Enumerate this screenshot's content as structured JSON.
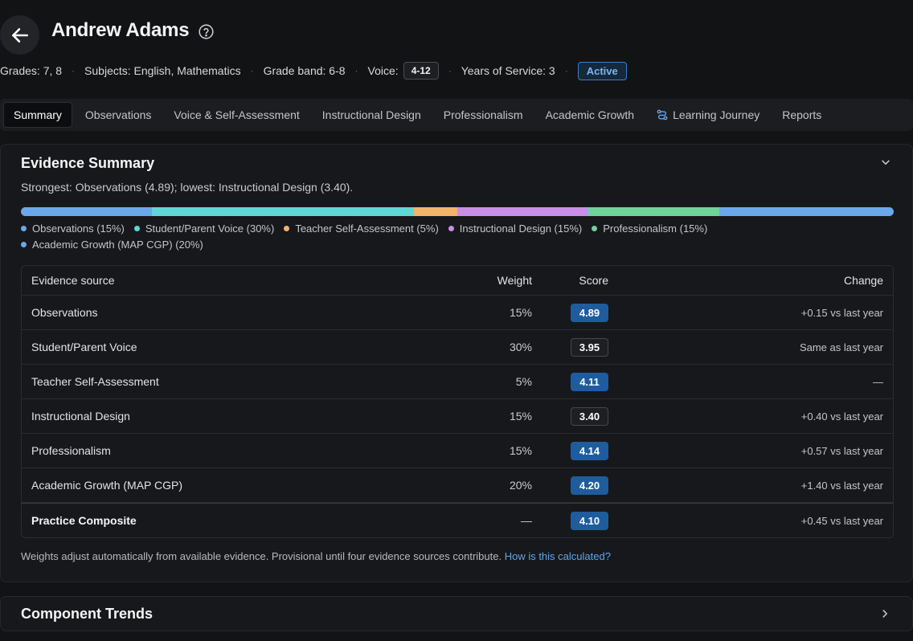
{
  "header": {
    "title": "Andrew Adams",
    "meta": {
      "grades": "Grades: 7, 8",
      "subjects": "Subjects: English, Mathematics",
      "grade_band": "Grade band: 6-8",
      "voice_label": "Voice:",
      "voice_value": "4-12",
      "years": "Years of Service: 3",
      "status": "Active",
      "separator": "·"
    }
  },
  "tabs": [
    {
      "label": "Summary",
      "active": true
    },
    {
      "label": "Observations"
    },
    {
      "label": "Voice & Self-Assessment"
    },
    {
      "label": "Instructional Design"
    },
    {
      "label": "Professionalism"
    },
    {
      "label": "Academic Growth"
    },
    {
      "label": "Learning Journey",
      "icon": "route-icon"
    },
    {
      "label": "Reports"
    }
  ],
  "evidence": {
    "title": "Evidence Summary",
    "summary": "Strongest: Observations (4.89); lowest: Instructional Design (3.40).",
    "weights": [
      {
        "label": "Observations (15%)",
        "fraction": 0.15,
        "color": "#6aa8ec"
      },
      {
        "label": "Student/Parent Voice (30%)",
        "fraction": 0.3,
        "color": "#5fd7d6"
      },
      {
        "label": "Teacher Self-Assessment (5%)",
        "fraction": 0.05,
        "color": "#f1b46a"
      },
      {
        "label": "Instructional Design (15%)",
        "fraction": 0.15,
        "color": "#c98ee8"
      },
      {
        "label": "Professionalism (15%)",
        "fraction": 0.15,
        "color": "#6fd39a"
      },
      {
        "label": "Academic Growth (MAP CGP) (20%)",
        "fraction": 0.2,
        "color": "#6aa8ec"
      }
    ],
    "table": {
      "headers": {
        "source": "Evidence source",
        "weight": "Weight",
        "score": "Score",
        "change": "Change"
      },
      "rows": [
        {
          "source": "Observations",
          "weight": "15%",
          "score": "4.89",
          "highlight": true,
          "change": "+0.15 vs last year"
        },
        {
          "source": "Student/Parent Voice",
          "weight": "30%",
          "score": "3.95",
          "highlight": false,
          "change": "Same as last year"
        },
        {
          "source": "Teacher Self-Assessment",
          "weight": "5%",
          "score": "4.11",
          "highlight": true,
          "change": "—"
        },
        {
          "source": "Instructional Design",
          "weight": "15%",
          "score": "3.40",
          "highlight": false,
          "change": "+0.40 vs last year"
        },
        {
          "source": "Professionalism",
          "weight": "15%",
          "score": "4.14",
          "highlight": true,
          "change": "+0.57 vs last year"
        },
        {
          "source": "Academic Growth (MAP CGP)",
          "weight": "20%",
          "score": "4.20",
          "highlight": true,
          "change": "+1.40 vs last year"
        }
      ],
      "composite": {
        "source": "Practice Composite",
        "weight": "—",
        "score": "4.10",
        "change": "+0.45 vs last year"
      }
    },
    "footnote": "Weights adjust automatically from available evidence. Provisional until four evidence sources contribute.",
    "footnote_link": "How is this calculated?"
  },
  "component_trends": {
    "title": "Component Trends"
  }
}
